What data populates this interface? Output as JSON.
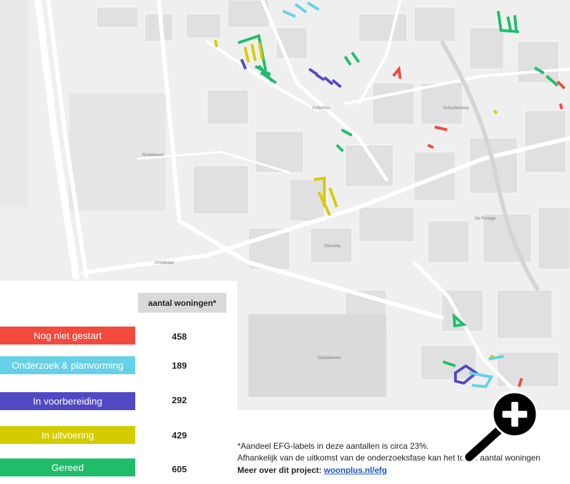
{
  "map": {
    "labels": [
      "Vinkebaan",
      "Schoutenburg",
      "Reukebuurt",
      "Ellesvilla",
      "Kulturhus",
      "Stadsboeren",
      "De Portage"
    ]
  },
  "legend": {
    "header": "aantal woningen*",
    "statuses": [
      {
        "label": "Nog niet gestart",
        "count": "458",
        "color": "#f4493d"
      },
      {
        "label": "Onderzoek & planvorming",
        "count": "189",
        "color": "#66d1e6"
      },
      {
        "label": "In voorbereiding",
        "count": "292",
        "color": "#5149c4"
      },
      {
        "label": "In uitvoering",
        "count": "429",
        "color": "#d5cc00"
      },
      {
        "label": "Gereed",
        "count": "605",
        "color": "#1fbd6a"
      }
    ]
  },
  "footnote": {
    "line1": "*Aandeel EFG-labels in deze aantallen is circa 23%.",
    "line2": " Afhankelijk van de uitkomst van de onderzoeksfase kan het totaal aantal woningen",
    "line3_prefix": "Meer over dit project: ",
    "link": "woonplus.nl/efg"
  },
  "zoom": {
    "icon": "zoom-in-magnifier-icon"
  }
}
